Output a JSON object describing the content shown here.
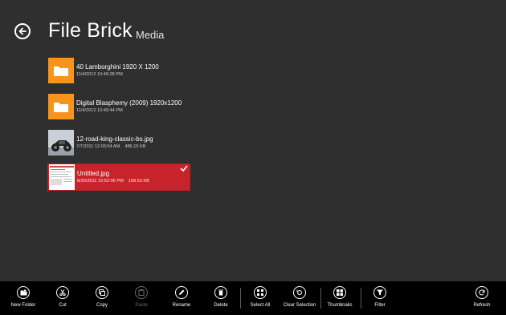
{
  "header": {
    "title": "File Brick",
    "subtitle": "Media"
  },
  "files": [
    {
      "name": "40 Lamborghini 1920 X 1200",
      "date": "11/4/2012 10:49:28 PM",
      "size": "",
      "type": "folder"
    },
    {
      "name": "Digital Blasphemy (2009) 1920x1200",
      "date": "11/4/2012 10:49:44 PM",
      "size": "",
      "type": "folder"
    },
    {
      "name": "12-road-king-classic-bs.jpg",
      "date": "7/7/2011 12:03:54 AM",
      "size": "486.15 KB",
      "type": "image"
    },
    {
      "name": "Untitled.jpg",
      "date": "8/30/2011 10:52:06 PM",
      "size": "168.53 KB",
      "type": "image",
      "selected": true
    }
  ],
  "appbar": {
    "new_folder": "New Folder",
    "cut": "Cut",
    "copy": "Copy",
    "paste": "Paste",
    "rename": "Rename",
    "delete": "Delete",
    "select_all": "Select All",
    "clear_selection": "Clear Selection",
    "thumbnails": "Thumbnails",
    "filter": "Filter",
    "refresh": "Refresh"
  },
  "colors": {
    "background": "#2f2f2f",
    "folder": "#f7941d",
    "selected": "#c8232b",
    "appbar": "#000000"
  }
}
